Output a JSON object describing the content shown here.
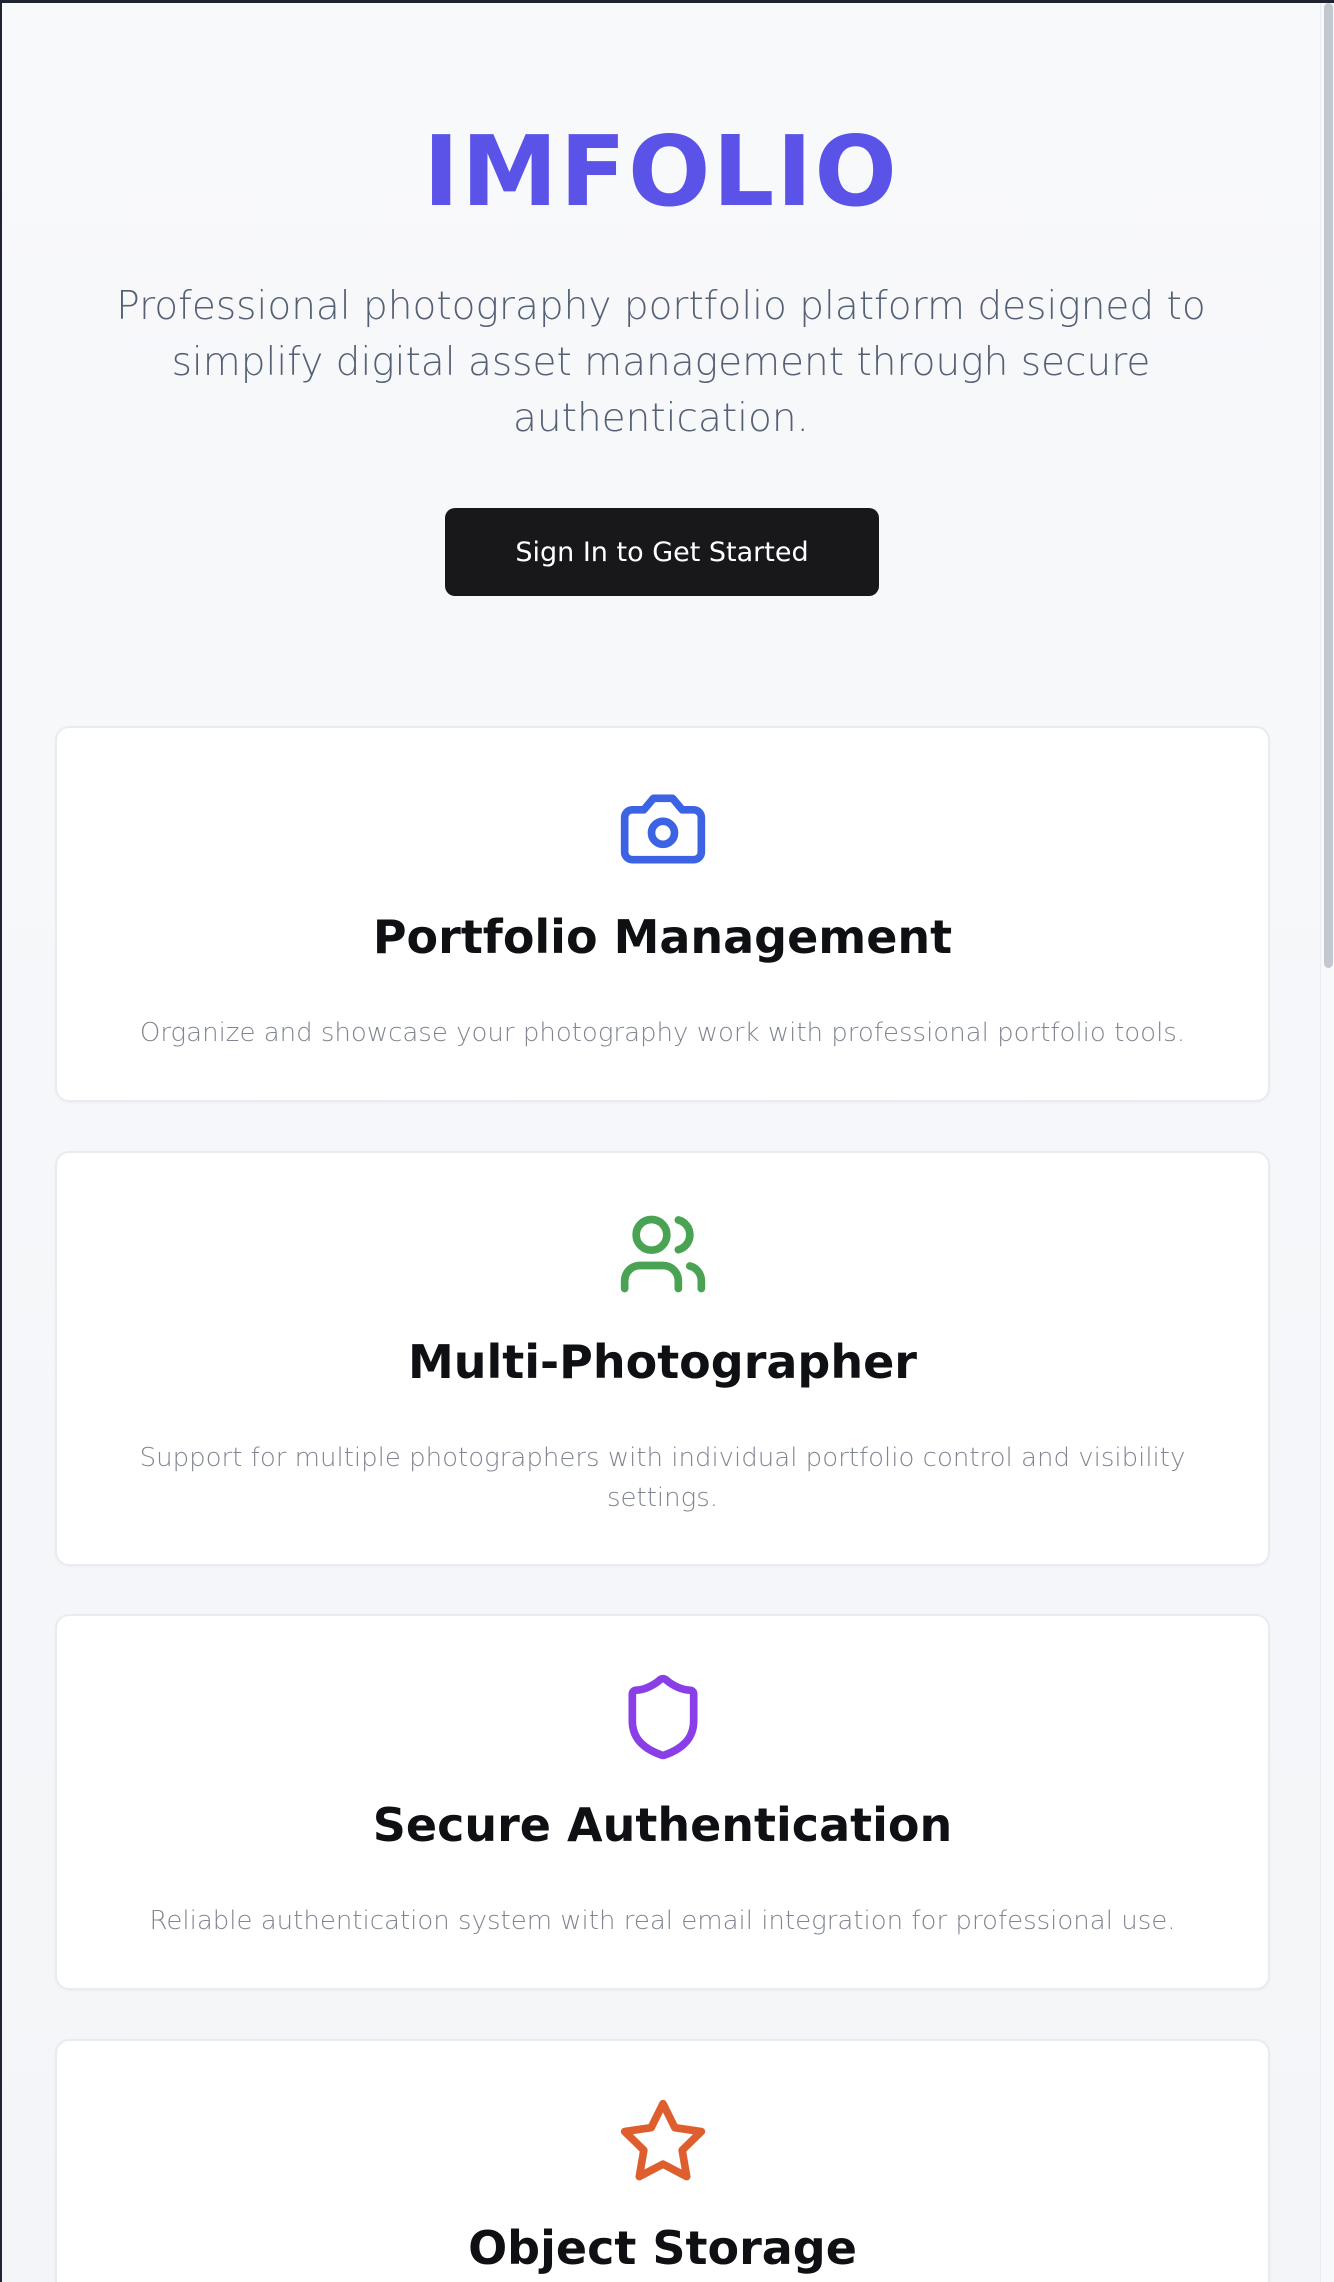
{
  "brand": {
    "name": "IMFOLIO"
  },
  "hero": {
    "tagline": "Professional photography portfolio platform designed to simplify digital asset management through secure authentication.",
    "cta": "Sign In to Get Started"
  },
  "features": [
    {
      "title": "Portfolio Management",
      "description": "Organize and showcase your photography work with professional portfolio tools.",
      "icon": "camera-icon",
      "color": "#3b63e3"
    },
    {
      "title": "Multi-Photographer",
      "description": "Support for multiple photographers with individual portfolio control and visibility settings.",
      "icon": "users-icon",
      "color": "#49a353"
    },
    {
      "title": "Secure Authentication",
      "description": "Reliable authentication system with real email integration for professional use.",
      "icon": "shield-icon",
      "color": "#8a3ee8"
    },
    {
      "title": "Object Storage",
      "description": "",
      "icon": "star-icon",
      "color": "#de5f2d"
    }
  ],
  "colors": {
    "brand": "#5b53e8",
    "tagline": "#566075",
    "cta_background": "#18181b",
    "cta_text": "#ffffff",
    "card_border": "#e8ebf0",
    "description": "#808591"
  }
}
